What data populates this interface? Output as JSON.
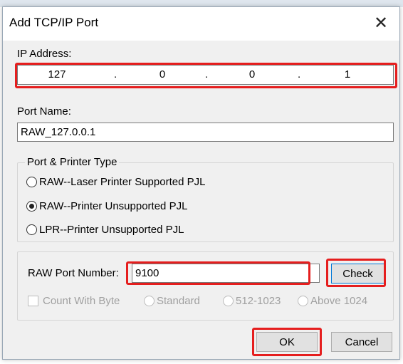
{
  "dialog": {
    "title": "Add TCP/IP Port",
    "close_glyph": "✕"
  },
  "ip_address": {
    "label": "IP Address:",
    "octets": [
      "127",
      "0",
      "0",
      "1"
    ],
    "separator": "."
  },
  "port_name": {
    "label": "Port Name:",
    "value": "RAW_127.0.0.1"
  },
  "port_type": {
    "group_label": "Port & Printer Type",
    "options": [
      {
        "label": "RAW--Laser Printer Supported PJL",
        "selected": false
      },
      {
        "label": "RAW--Printer Unsupported PJL",
        "selected": true
      },
      {
        "label": "LPR--Printer Unsupported PJL",
        "selected": false
      }
    ]
  },
  "raw_port": {
    "label": "RAW Port Number:",
    "value": "9100",
    "check_label": "Check",
    "count_with_byte_label": "Count With Byte",
    "range_options": [
      "Standard",
      "512-1023",
      "Above 1024"
    ]
  },
  "buttons": {
    "ok": "OK",
    "cancel": "Cancel"
  },
  "colors": {
    "highlight": "#e51e1e",
    "dialog_bg": "#f0f0f0",
    "focus_border": "#0078d7"
  }
}
